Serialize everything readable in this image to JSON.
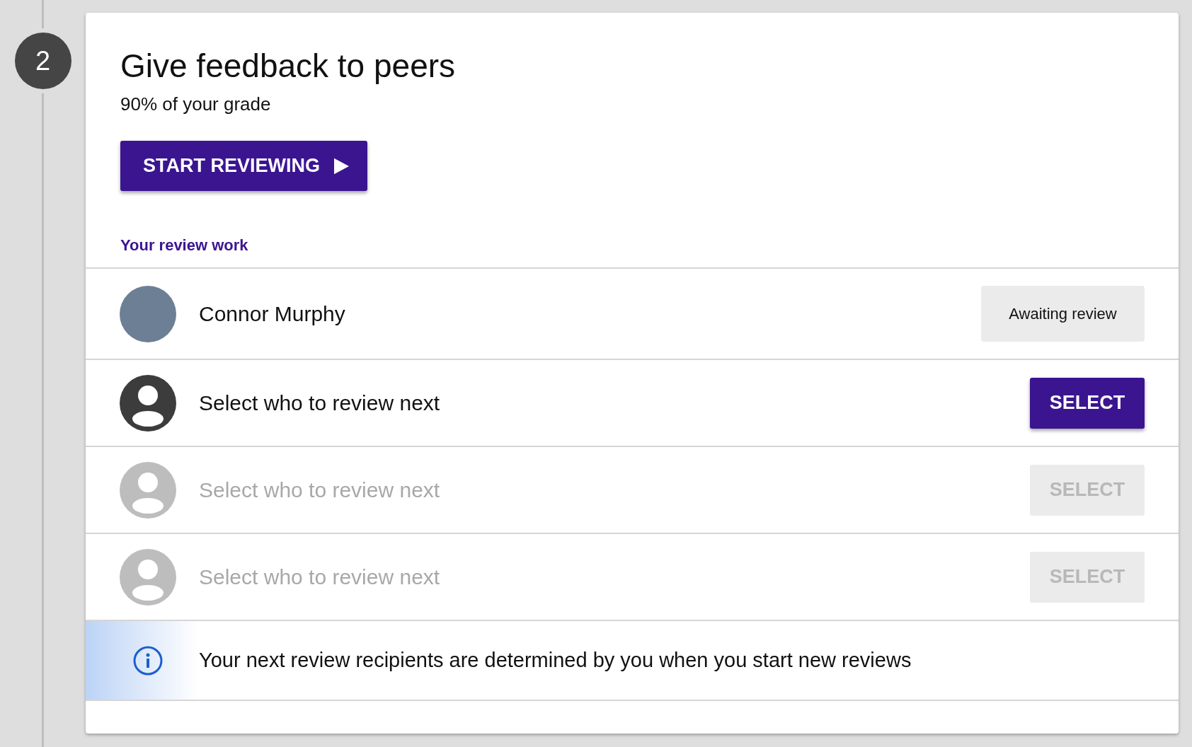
{
  "step": {
    "number": "2"
  },
  "header": {
    "title": "Give feedback to peers",
    "subtitle": "90% of your grade",
    "button": "START REVIEWING"
  },
  "section_label": "Your review work",
  "rows": [
    {
      "kind": "reviewee",
      "name": "Connor Murphy",
      "status": "Awaiting review"
    },
    {
      "kind": "slot",
      "label": "Select who to review next",
      "action": "SELECT",
      "disabled": false
    },
    {
      "kind": "slot",
      "label": "Select who to review next",
      "action": "SELECT",
      "disabled": true
    },
    {
      "kind": "slot",
      "label": "Select who to review next",
      "action": "SELECT",
      "disabled": true
    }
  ],
  "info": {
    "text": "Your next review recipients are determined by you when you start new reviews"
  }
}
